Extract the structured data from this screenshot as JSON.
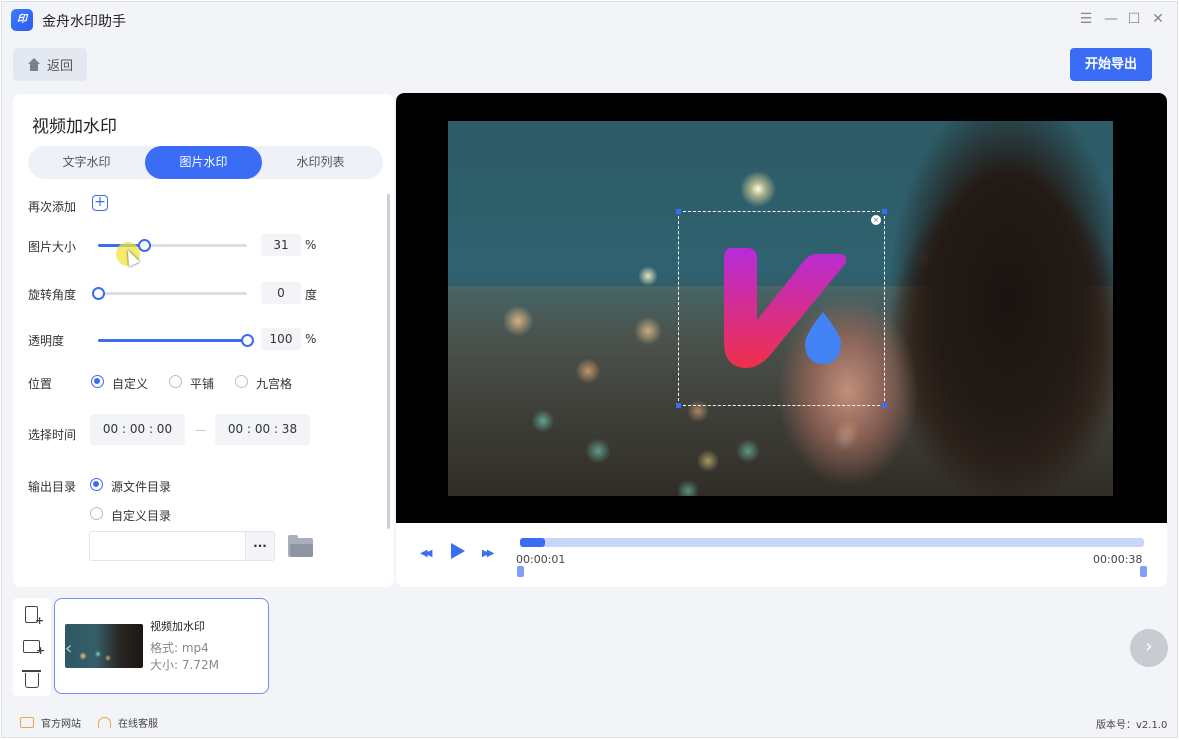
{
  "app": {
    "title": "金舟水印助手",
    "logo_text": "印"
  },
  "window_controls": {
    "menu": "☰",
    "minimize": "—",
    "maximize": "☐",
    "close": "✕"
  },
  "toolbar": {
    "back_label": "返回",
    "export_label": "开始导出"
  },
  "panel": {
    "title": "视频加水印",
    "tabs": [
      {
        "label": "文字水印",
        "active": false
      },
      {
        "label": "图片水印",
        "active": true
      },
      {
        "label": "水印列表",
        "active": false
      }
    ],
    "add_again_label": "再次添加",
    "size": {
      "label": "图片大小",
      "value": "31",
      "unit": "%",
      "level": 0.31
    },
    "rotation": {
      "label": "旋转角度",
      "value": "0",
      "unit": "度",
      "level": 0.0
    },
    "opacity": {
      "label": "透明度",
      "value": "100",
      "unit": "%",
      "level": 1.0
    },
    "position": {
      "label": "位置",
      "options": [
        {
          "label": "自定义",
          "checked": true
        },
        {
          "label": "平铺",
          "checked": false
        },
        {
          "label": "九宫格",
          "checked": false
        }
      ]
    },
    "time_range": {
      "label": "选择时间",
      "start": "00 : 00 : 00",
      "end": "00 : 00 : 38"
    },
    "output": {
      "label": "输出目录",
      "options": [
        {
          "label": "源文件目录",
          "checked": true
        },
        {
          "label": "自定义目录",
          "checked": false
        }
      ],
      "path_value": "",
      "browse_label": "···"
    }
  },
  "player": {
    "current_time": "00:00:01",
    "total_time": "00:00:38",
    "progress": 0.03,
    "watermark_close": "×"
  },
  "file_list": {
    "items": [
      {
        "name": "视频加水印",
        "format": "格式: mp4",
        "size": "大小: 7.72M"
      }
    ],
    "next_arrow": "›"
  },
  "footer": {
    "official_site": "官方网站",
    "online_support": "在线客服",
    "version": "版本号：v2.1.0"
  },
  "colors": {
    "accent": "#3a6cf6",
    "logo_magenta": "#c22bd8",
    "logo_red": "#f0304a",
    "logo_blue": "#4383f5"
  }
}
